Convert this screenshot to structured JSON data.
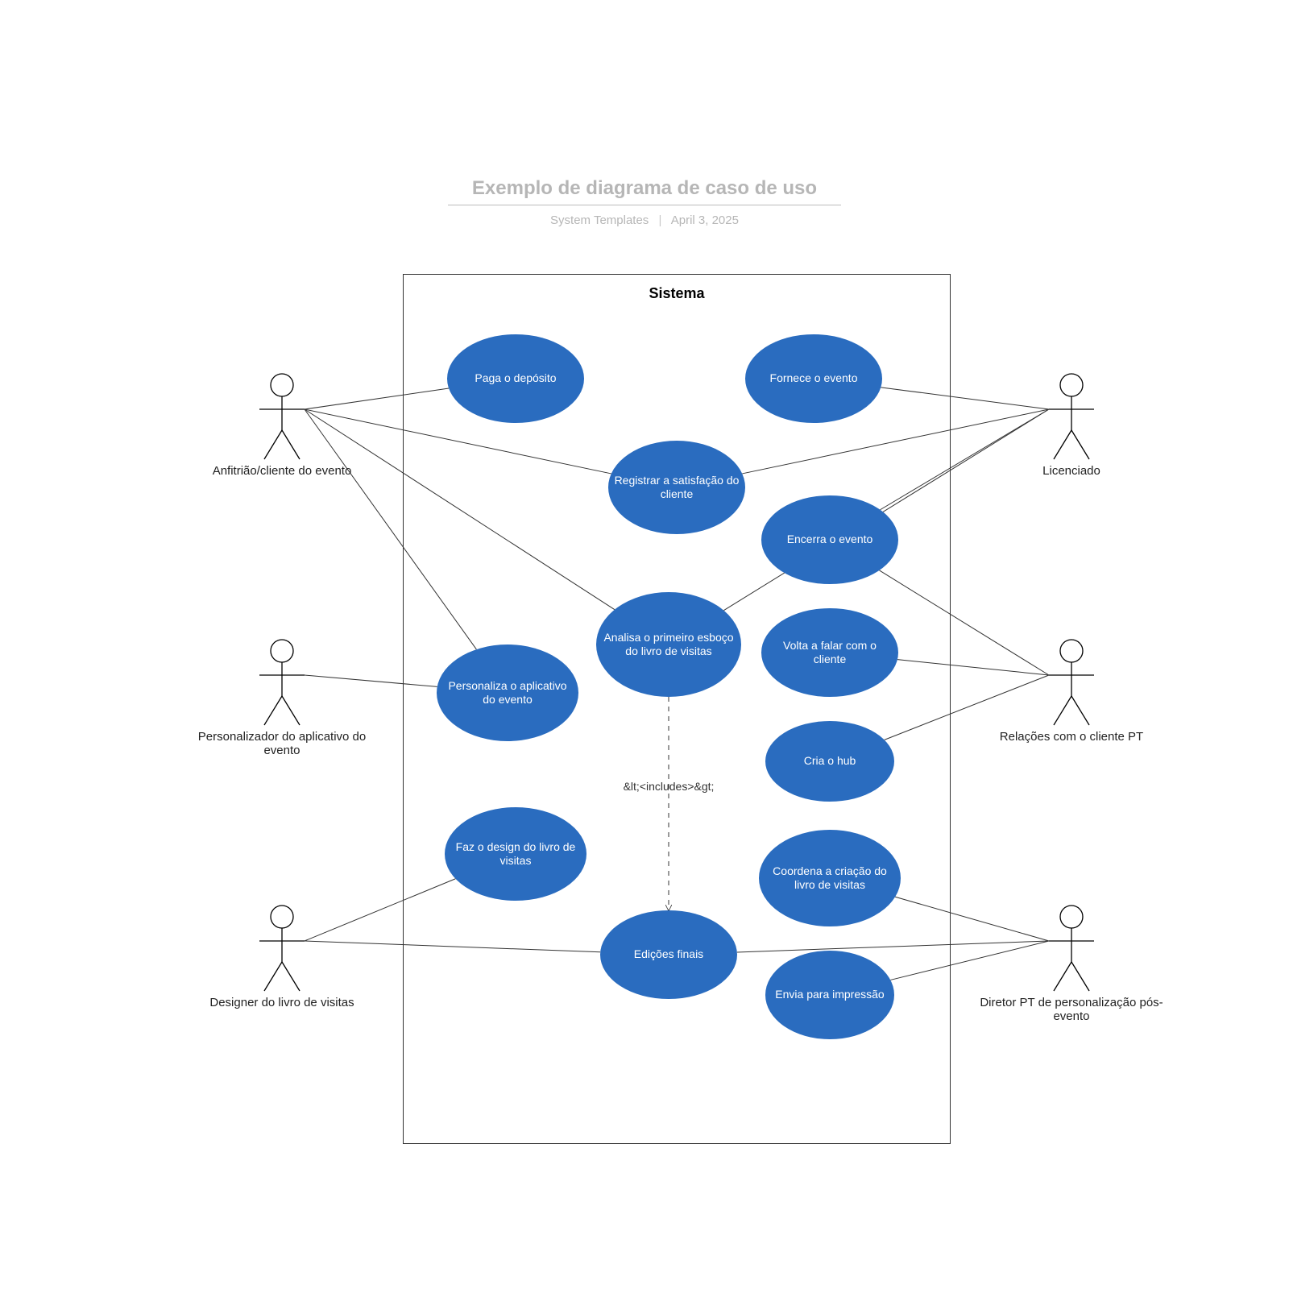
{
  "title": "Exemplo de diagrama de caso de uso",
  "subtitle_author": "System Templates",
  "subtitle_date": "April 3, 2025",
  "system_label": "Sistema",
  "colors": {
    "usecase_fill": "#2a6cbf",
    "usecase_text": "#ffffff"
  },
  "actors": {
    "host": {
      "label": "Anfitrião/cliente do evento"
    },
    "customizer": {
      "label": "Personalizador do aplicativo do evento"
    },
    "designer": {
      "label": "Designer do livro de visitas"
    },
    "licensee": {
      "label": "Licenciado"
    },
    "relations": {
      "label": "Relações com o cliente PT"
    },
    "director": {
      "label": "Diretor PT de personalização pós-evento"
    }
  },
  "usecases": {
    "pay_deposit": {
      "label": "Paga o depósito"
    },
    "provide_event": {
      "label": "Fornece o evento"
    },
    "record_sat": {
      "label": "Registrar a satisfação do cliente"
    },
    "close_event": {
      "label": "Encerra o evento"
    },
    "review_draft": {
      "label": "Analisa o primeiro esboço do livro de visitas"
    },
    "follow_up": {
      "label": "Volta a falar com o cliente"
    },
    "customize_app": {
      "label": "Personaliza o aplicativo do evento"
    },
    "create_hub": {
      "label": "Cria o hub"
    },
    "design_book": {
      "label": "Faz o design do livro de visitas"
    },
    "coord_book": {
      "label": "Coordena a criação do livro de visitas"
    },
    "final_edits": {
      "label": "Edições finais"
    },
    "send_print": {
      "label": "Envia para impressão"
    }
  },
  "edge_labels": {
    "includes": "&lt;<includes>&gt;"
  },
  "connections": [
    {
      "from_actor": "host",
      "to_usecase": "pay_deposit"
    },
    {
      "from_actor": "host",
      "to_usecase": "record_sat"
    },
    {
      "from_actor": "host",
      "to_usecase": "review_draft"
    },
    {
      "from_actor": "host",
      "to_usecase": "customize_app"
    },
    {
      "from_actor": "customizer",
      "to_usecase": "customize_app"
    },
    {
      "from_actor": "designer",
      "to_usecase": "design_book"
    },
    {
      "from_actor": "designer",
      "to_usecase": "final_edits"
    },
    {
      "from_actor": "licensee",
      "to_usecase": "provide_event"
    },
    {
      "from_actor": "licensee",
      "to_usecase": "record_sat"
    },
    {
      "from_actor": "licensee",
      "to_usecase": "close_event"
    },
    {
      "from_actor": "licensee",
      "to_usecase": "review_draft"
    },
    {
      "from_actor": "relations",
      "to_usecase": "close_event"
    },
    {
      "from_actor": "relations",
      "to_usecase": "follow_up"
    },
    {
      "from_actor": "relations",
      "to_usecase": "create_hub"
    },
    {
      "from_actor": "director",
      "to_usecase": "coord_book"
    },
    {
      "from_actor": "director",
      "to_usecase": "final_edits"
    },
    {
      "from_actor": "director",
      "to_usecase": "send_print"
    }
  ],
  "include_edge": {
    "from_usecase": "review_draft",
    "to_usecase": "final_edits"
  }
}
